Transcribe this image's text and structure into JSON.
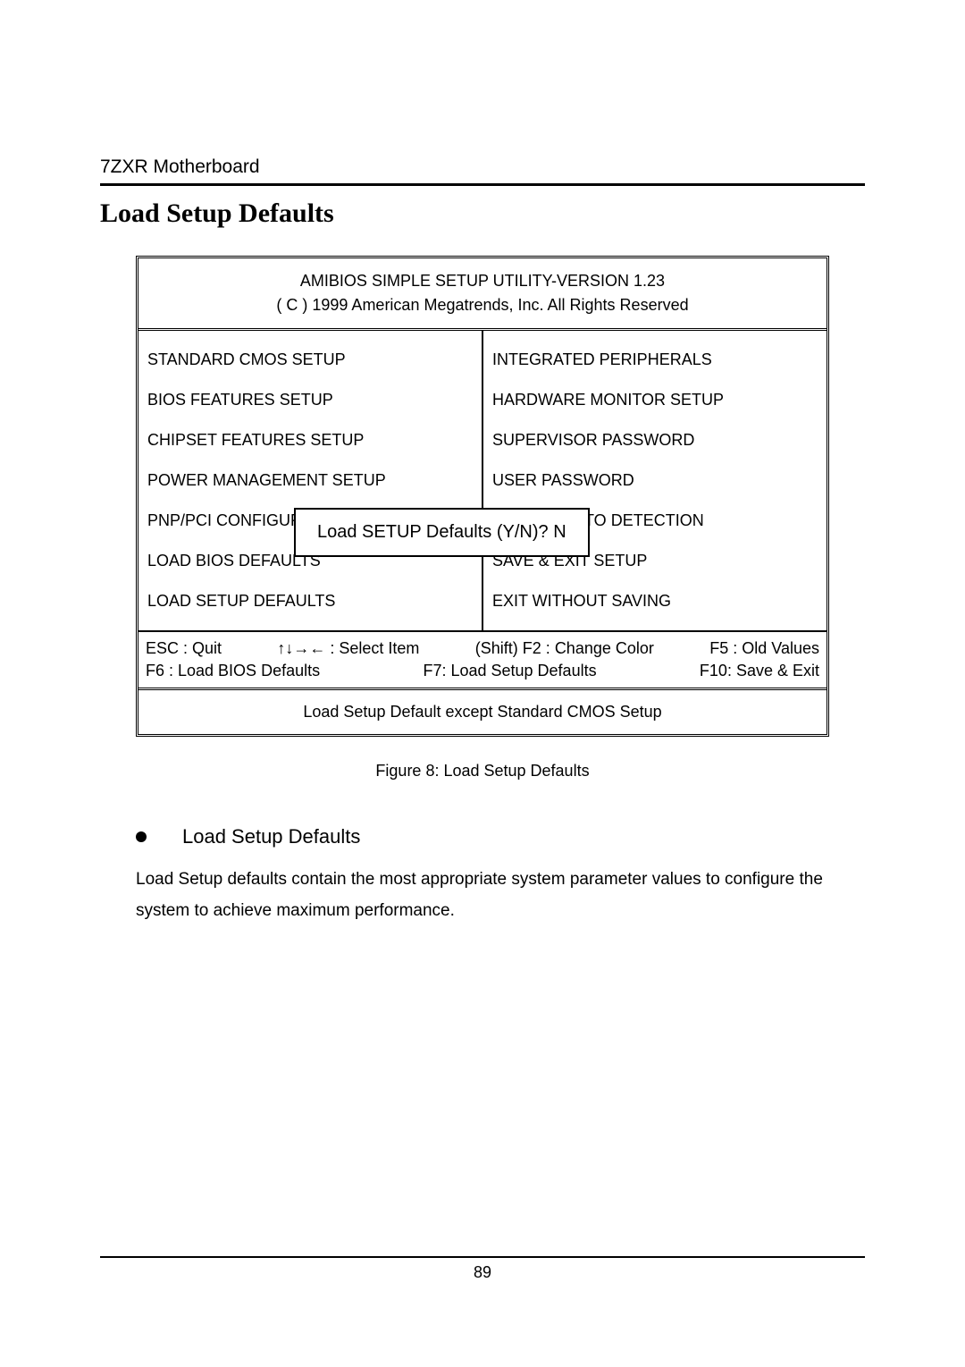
{
  "doc": {
    "header": "7ZXR Motherboard",
    "section_title": "Load Setup Defaults",
    "figure_caption": "Figure 8: Load Setup Defaults",
    "bullet_title": "Load Setup Defaults",
    "body_text": "Load Setup defaults contain the most appropriate system parameter values to configure the system to achieve maximum performance.",
    "page_number": "89"
  },
  "bios": {
    "title_line1": "AMIBIOS SIMPLE SETUP UTILITY-VERSION 1.23",
    "title_line2": "( C ) 1999 American Megatrends, Inc. All Rights Reserved",
    "menu_left": [
      "STANDARD CMOS SETUP",
      "BIOS FEATURES SETUP",
      "CHIPSET FEATURES SETUP",
      "POWER MANAGEMENT SETUP",
      "PNP/PCI CONFIGURATION",
      "LOAD BIOS DEFAULTS",
      "LOAD SETUP DEFAULTS"
    ],
    "menu_right": [
      "INTEGRATED PERIPHERALS",
      "HARDWARE MONITOR SETUP",
      "SUPERVISOR PASSWORD",
      "USER PASSWORD",
      "IDE HDD AUTO DETECTION",
      "SAVE & EXIT SETUP",
      "EXIT WITHOUT SAVING"
    ],
    "dialog_text": "Load SETUP Defaults (Y/N)? N",
    "footer": {
      "l1_a": "ESC : Quit",
      "l1_b": "↑↓→← : Select Item",
      "l1_c": "(Shift) F2 : Change Color",
      "l1_d": "F5 : Old Values",
      "l2_a": "F6 : Load BIOS Defaults",
      "l2_b": "F7: Load Setup Defaults",
      "l2_c": "F10: Save & Exit"
    },
    "hint": "Load Setup Default except Standard CMOS Setup"
  }
}
